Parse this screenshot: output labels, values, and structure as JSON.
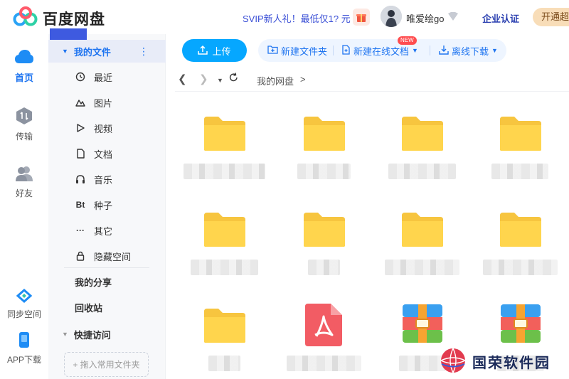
{
  "header": {
    "brand": "百度网盘",
    "promo": "SVIP新人礼！最低仅1? 元",
    "username": "唯爱绘go",
    "enterprise": "企业认证",
    "open_vip": "开通超级"
  },
  "rail": {
    "items": [
      {
        "label": "首页",
        "icon": "cloud-icon",
        "active": true
      },
      {
        "label": "传输",
        "icon": "transfer-icon",
        "active": false
      },
      {
        "label": "好友",
        "icon": "friends-icon",
        "active": false
      }
    ],
    "bottom": [
      {
        "label": "同步空间",
        "icon": "sync-icon"
      },
      {
        "label": "APP下载",
        "icon": "phone-icon"
      }
    ]
  },
  "nav": {
    "my_files": "我的文件",
    "items": [
      {
        "label": "最近",
        "icon": "clock-icon"
      },
      {
        "label": "图片",
        "icon": "picture-icon"
      },
      {
        "label": "视频",
        "icon": "play-icon"
      },
      {
        "label": "文档",
        "icon": "document-icon"
      },
      {
        "label": "音乐",
        "icon": "headphones-icon"
      },
      {
        "label": "种子",
        "icon": "bt-icon",
        "glyph": "Bt"
      },
      {
        "label": "其它",
        "icon": "more-icon",
        "glyph": "···"
      },
      {
        "label": "隐藏空间",
        "icon": "lock-icon"
      }
    ],
    "my_share": "我的分享",
    "recycle": "回收站",
    "quick_access": "快捷访问",
    "drag_hint": "+ 拖入常用文件夹"
  },
  "toolbar": {
    "upload": "上传",
    "new_folder": "新建文件夹",
    "new_online_doc": "新建在线文档",
    "new_tag": "NEW",
    "offline_download": "离线下载"
  },
  "breadcrumb": {
    "root": "我的网盘",
    "sep": ">"
  },
  "files": [
    {
      "type": "folder"
    },
    {
      "type": "folder"
    },
    {
      "type": "folder"
    },
    {
      "type": "folder"
    },
    {
      "type": "folder"
    },
    {
      "type": "folder"
    },
    {
      "type": "folder"
    },
    {
      "type": "folder"
    },
    {
      "type": "folder"
    },
    {
      "type": "pdf"
    },
    {
      "type": "archive"
    },
    {
      "type": "archive"
    }
  ],
  "watermark": {
    "text": "国荣软件园"
  },
  "colors": {
    "accent": "#1e74f0",
    "upload": "#06a7ff",
    "folder": "#ffd54d",
    "pdf": "#f25c64"
  }
}
